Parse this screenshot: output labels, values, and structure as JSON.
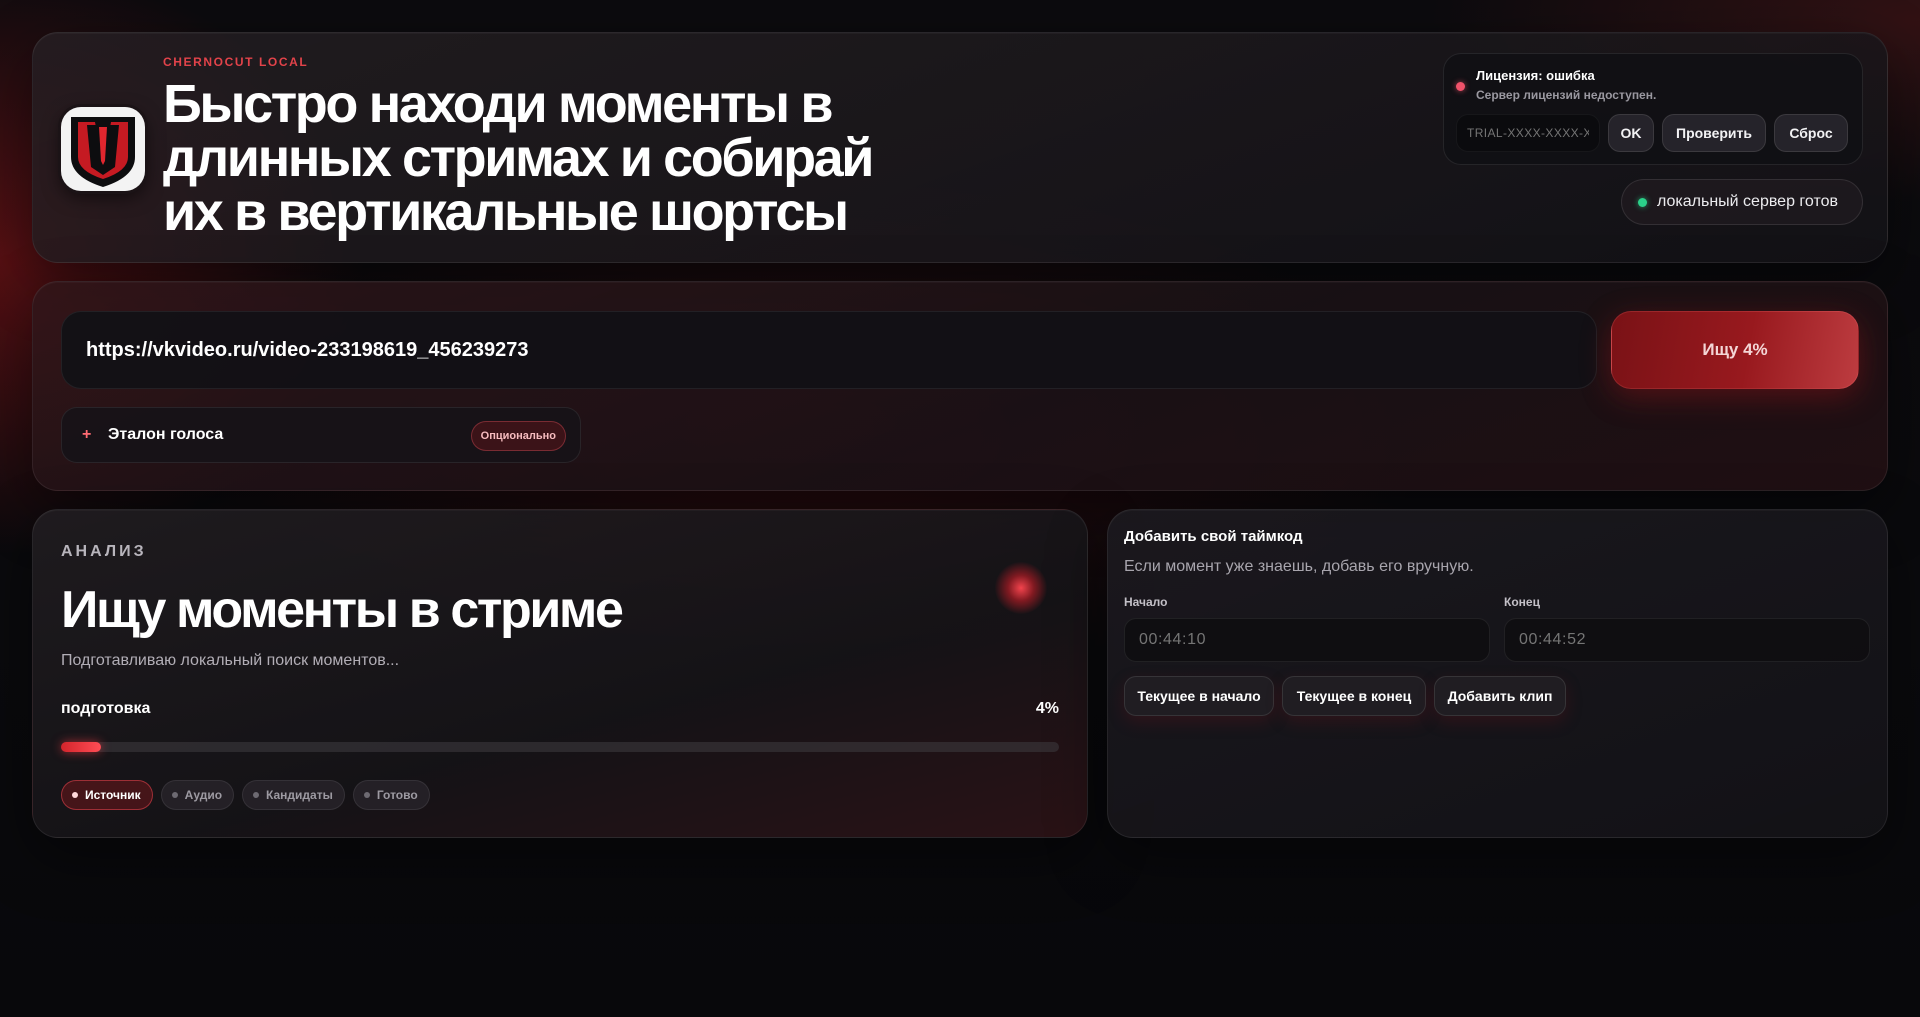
{
  "hero": {
    "brand": "CHERNOCUT LOCAL",
    "title": "Быстро находи моменты в длинных стримах и собирай их в вертикальные шортсы"
  },
  "license": {
    "title": "Лицензия: ошибка",
    "subtitle": "Сервер лицензий недоступен.",
    "key_placeholder": "TRIAL-XXXX-XXXX-X",
    "ok_label": "OK",
    "check_label": "Проверить",
    "reset_label": "Сброс",
    "status_color": "#f0526a"
  },
  "server_status": {
    "label": "локальный сервер готов",
    "status_color": "#2bd18a"
  },
  "source": {
    "url": "https://vkvideo.ru/video-233198619_456239273",
    "search_button": "Ищу 4%",
    "voice_plus": "+",
    "voice_label": "Эталон голоса",
    "voice_badge": "Опционально"
  },
  "analysis": {
    "kicker": "АНАЛИЗ",
    "title": "Ищу моменты в стриме",
    "subtitle": "Подготавливаю локальный поиск моментов...",
    "stage": "подготовка",
    "progress_label": "4%",
    "progress": 0.04,
    "steps": [
      {
        "label": "Источник",
        "active": true
      },
      {
        "label": "Аудио",
        "active": false
      },
      {
        "label": "Кандидаты",
        "active": false
      },
      {
        "label": "Готово",
        "active": false
      }
    ]
  },
  "timecode": {
    "title": "Добавить свой таймкод",
    "subtitle": "Если момент уже знаешь, добавь его вручную.",
    "start_label": "Начало",
    "start_placeholder": "00:44:10",
    "end_label": "Конец",
    "end_placeholder": "00:44:52",
    "btn_current_start": "Текущее в начало",
    "btn_current_end": "Текущее в конец",
    "btn_add_clip": "Добавить клип"
  },
  "colors": {
    "accent": "#d3242b",
    "accent_text": "#e2434a"
  }
}
